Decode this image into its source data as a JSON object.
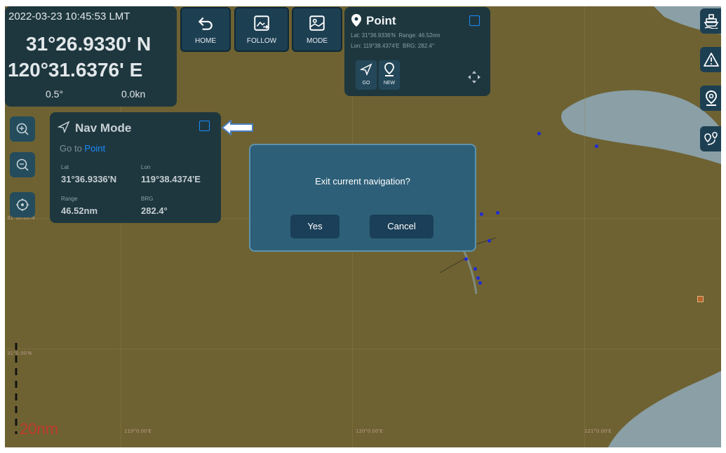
{
  "status": {
    "datetime": "2022-03-23 10:45:53 LMT",
    "latitude": "31°26.9330' N",
    "longitude": "120°31.6376' E",
    "heading": "0.5°",
    "speed": "0.0kn"
  },
  "toolbar": {
    "home_label": "HOME",
    "follow_label": "FOLLOW",
    "mode_label": "MODE"
  },
  "point_panel": {
    "title": "Point",
    "lat_label": "Lat:",
    "lat_value": "31°36.9336'N",
    "range_label": "Range:",
    "range_value": "46.52nm",
    "lon_label": "Lon:",
    "lon_value": "119°38.4374'E",
    "brg_label": "BRG:",
    "brg_value": "282.4°",
    "go_label": "GO",
    "new_label": "NEW"
  },
  "nav_mode": {
    "title": "Nav Mode",
    "goto_prefix": "Go to",
    "goto_target": "Point",
    "lat_label": "Lat",
    "lat_value": "31°36.9336'N",
    "lon_label": "Lon",
    "lon_value": "119°38.4374'E",
    "range_label": "Range",
    "range_value": "46.52nm",
    "brg_label": "BRG",
    "brg_value": "282.4°"
  },
  "map": {
    "lat_labels": [
      "31°30.00'N",
      "31°0.00'N"
    ],
    "lon_labels": [
      "119°0.00'E",
      "120°0.00'E",
      "121°0.00'E"
    ],
    "scale_label": "20nm"
  },
  "dialog": {
    "message": "Exit current navigation?",
    "yes_label": "Yes",
    "cancel_label": "Cancel"
  },
  "colors": {
    "map_land": "#6e6232",
    "water": "#8a9fa6",
    "panel": "#183440",
    "dialog": "#2d5f78",
    "accent_blue": "#1a8cff",
    "scale_red": "#c0392b"
  }
}
